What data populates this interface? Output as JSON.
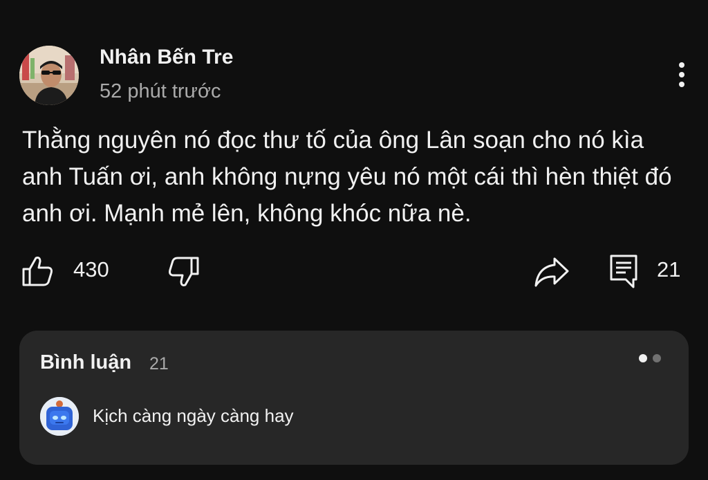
{
  "post": {
    "author": "Nhân Bến Tre",
    "timestamp": "52 phút trước",
    "text": "Thằng nguyên nó đọc thư tố của ông Lân soạn cho nó kìa anh Tuấn ơi, anh không nựng yêu nó một cái thì hèn thiệt đó anh ơi. Mạnh mẻ lên, không khóc nữa nè."
  },
  "actions": {
    "likes": "430",
    "comments": "21",
    "icons": {
      "like": "thumbs-up-icon",
      "dislike": "thumbs-down-icon",
      "share": "share-icon",
      "comment": "comment-icon",
      "more": "more-vertical-icon"
    }
  },
  "comments_panel": {
    "title": "Bình luận",
    "count": "21",
    "pager": {
      "pages": 2,
      "active_index": 0
    },
    "top_comment": {
      "text": "Kịch càng ngày càng hay"
    }
  },
  "colors": {
    "background": "#0f0f0f",
    "panel": "#272727",
    "text_primary": "#f1f1f1",
    "text_secondary": "#aaaaaa"
  }
}
